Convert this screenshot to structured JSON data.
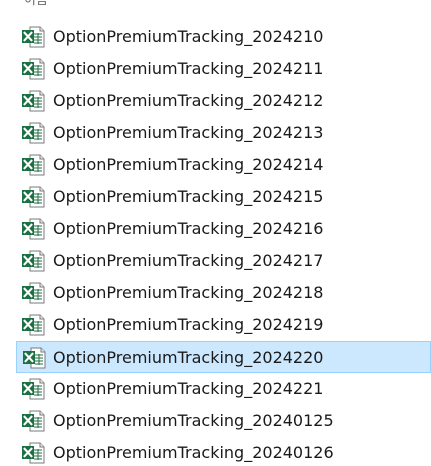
{
  "column_header": "이름",
  "icon": "excel-file-icon",
  "colors": {
    "selection_bg": "#cce8ff",
    "selection_border": "#99d1ff",
    "excel_green": "#1d7044"
  },
  "files": [
    {
      "name": "OptionPremiumTracking_2024210",
      "selected": false
    },
    {
      "name": "OptionPremiumTracking_2024211",
      "selected": false
    },
    {
      "name": "OptionPremiumTracking_2024212",
      "selected": false
    },
    {
      "name": "OptionPremiumTracking_2024213",
      "selected": false
    },
    {
      "name": "OptionPremiumTracking_2024214",
      "selected": false
    },
    {
      "name": "OptionPremiumTracking_2024215",
      "selected": false
    },
    {
      "name": "OptionPremiumTracking_2024216",
      "selected": false
    },
    {
      "name": "OptionPremiumTracking_2024217",
      "selected": false
    },
    {
      "name": "OptionPremiumTracking_2024218",
      "selected": false
    },
    {
      "name": "OptionPremiumTracking_2024219",
      "selected": false
    },
    {
      "name": "OptionPremiumTracking_2024220",
      "selected": true
    },
    {
      "name": "OptionPremiumTracking_2024221",
      "selected": false
    },
    {
      "name": "OptionPremiumTracking_20240125",
      "selected": false
    },
    {
      "name": "OptionPremiumTracking_20240126",
      "selected": false
    }
  ]
}
